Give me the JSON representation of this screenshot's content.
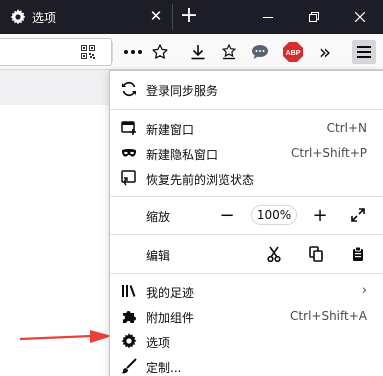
{
  "tab": {
    "title": "选项",
    "icon": "gear-icon"
  },
  "window": {
    "new_tab_icon": "plus-icon",
    "controls": [
      "minimize-icon",
      "restore-icon",
      "close-icon"
    ]
  },
  "toolbar": {
    "icons": [
      "qr-code-icon",
      "more-actions-icon",
      "bookmark-star-icon",
      "download-icon",
      "save-icon",
      "chat-icon",
      "adblock-icon",
      "overflow-icon",
      "hamburger-menu-icon"
    ],
    "adblock_label": "ABP",
    "overflow_label": "»"
  },
  "menu": {
    "sync": {
      "label": "登录同步服务",
      "icon": "sync-icon"
    },
    "new_window": {
      "label": "新建窗口",
      "shortcut": "Ctrl+N",
      "icon": "new-window-icon"
    },
    "private_window": {
      "label": "新建隐私窗口",
      "shortcut": "Ctrl+Shift+P",
      "icon": "mask-icon"
    },
    "restore_session": {
      "label": "恢复先前的浏览状态",
      "icon": "restore-session-icon"
    },
    "zoom": {
      "label": "缩放",
      "minus": "−",
      "value": "100%",
      "plus": "+",
      "fullscreen_icon": "fullscreen-icon"
    },
    "edit": {
      "label": "编辑",
      "cut_icon": "cut-icon",
      "copy_icon": "copy-icon",
      "paste_icon": "paste-icon"
    },
    "library": {
      "label": "我的足迹",
      "chevron": "›",
      "icon": "library-icon"
    },
    "addons": {
      "label": "附加组件",
      "shortcut": "Ctrl+Shift+A",
      "icon": "puzzle-icon"
    },
    "options": {
      "label": "选项",
      "icon": "gear-icon"
    },
    "customize": {
      "label": "定制...",
      "icon": "brush-icon"
    }
  },
  "annotation": {
    "arrow_color": "#e8413a"
  },
  "colors": {
    "tabstrip": "#1d1d27",
    "toolbar": "#f9f9fa",
    "adblock_red": "#d92b2b",
    "accent": "#0a84ff"
  }
}
